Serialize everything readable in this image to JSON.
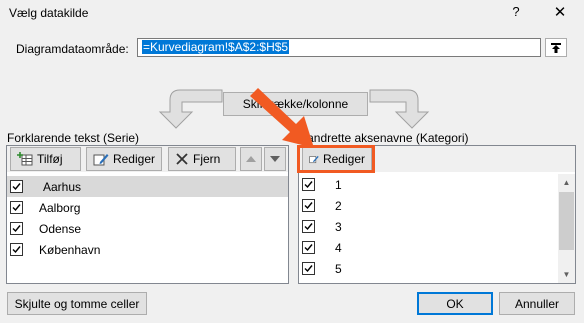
{
  "window": {
    "title": "Vælg datakilde",
    "help_glyph": "?",
    "close_glyph": "✕"
  },
  "range": {
    "label": "Diagramdataområde:",
    "value": "=Kurvediagram!$A$2:$H$5"
  },
  "switch_button": {
    "label": "Skift række/kolonne"
  },
  "series_panel": {
    "label": "Forklarende tekst (Serie)",
    "add_label": "Tilføj",
    "edit_label": "Rediger",
    "remove_label": "Fjern",
    "items": [
      {
        "label": "Aarhus",
        "checked": true,
        "selected": true
      },
      {
        "label": "Aalborg",
        "checked": true,
        "selected": false
      },
      {
        "label": "Odense",
        "checked": true,
        "selected": false
      },
      {
        "label": "København",
        "checked": true,
        "selected": false
      }
    ]
  },
  "category_panel": {
    "label": "Vandrette aksenavne (Kategori)",
    "edit_label": "Rediger",
    "items": [
      {
        "label": "1",
        "checked": true
      },
      {
        "label": "2",
        "checked": true
      },
      {
        "label": "3",
        "checked": true
      },
      {
        "label": "4",
        "checked": true
      },
      {
        "label": "5",
        "checked": true
      }
    ]
  },
  "footer": {
    "hidden_cells_label": "Skjulte og tomme celler",
    "ok_label": "OK",
    "cancel_label": "Annuller"
  },
  "colors": {
    "highlight": "#f15a22",
    "selection": "#0078d7"
  },
  "icons": [
    "help-icon",
    "close-icon",
    "collapse-range-icon",
    "switch-arrows-icon",
    "add-series-icon",
    "edit-icon",
    "remove-icon",
    "move-up-icon",
    "move-down-icon",
    "pointer-arrow-icon"
  ]
}
